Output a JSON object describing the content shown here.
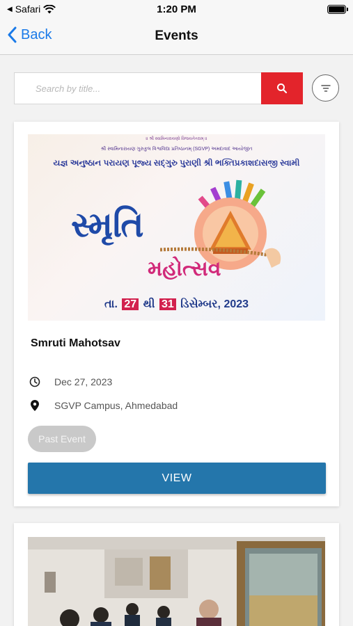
{
  "status_bar": {
    "carrier": "Safari",
    "time": "1:20 PM"
  },
  "nav": {
    "back_label": "Back",
    "title": "Events"
  },
  "search": {
    "placeholder": "Search by title..."
  },
  "events": [
    {
      "title": "Smruti Mahotsav",
      "date": "Dec 27, 2023",
      "location": "SGVP Campus, Ahmedabad",
      "status_badge": "Past Event",
      "view_label": "VIEW",
      "poster": {
        "line1": "॥ શ્રી સ્વામિનારાયણો વિજયતેતરામ્ ॥",
        "line2": "શ્રી સ્વામિનારાયણ ગુરુકુલ વિશ્વવિદ્યા પ્રતિષ્ઠાનમ્ (SGVP) અમદાવાદ આયોજીત",
        "line3": "યજ્ઞ અનુષ્ઠાન પરાયણ પૂજ્ય સદ્‌ગુરુ પુરાણી શ્રી ભક્તિપ્રકાશદાસજી સ્વામી",
        "main": "સ્મૃતિ",
        "sub": "મહોત્સવ",
        "date_prefix": "તા.",
        "date_from": "27",
        "date_mid": "થી",
        "date_to": "31",
        "date_suffix": "ડિસેમ્બર, 2023"
      }
    },
    {}
  ],
  "colors": {
    "accent_blue": "#1a7ae8",
    "search_red": "#e3242b",
    "view_button": "#2476ab",
    "badge_gray": "#c9c9c9"
  }
}
